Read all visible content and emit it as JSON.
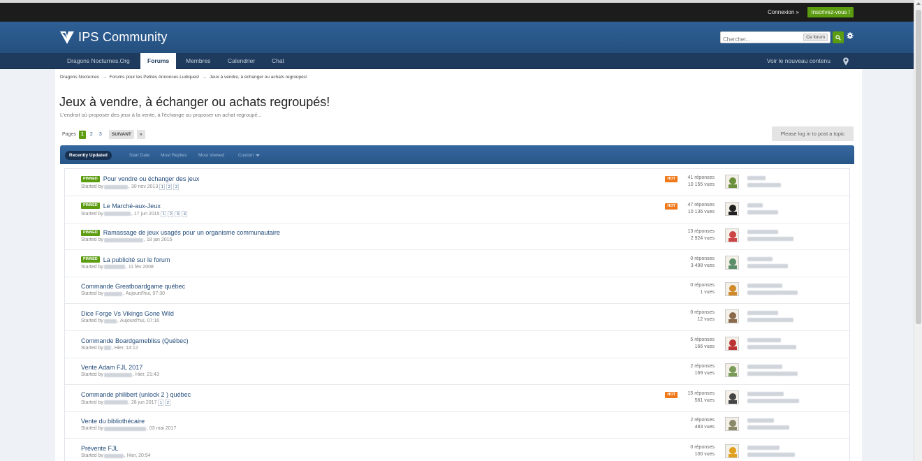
{
  "userbar": {
    "login": "Connexion »",
    "register": "Inscrivez-vous !"
  },
  "header": {
    "site_name": "IPS Community",
    "search_placeholder": "Chercher...",
    "search_scope": "Ce forum"
  },
  "nav": {
    "tabs": [
      "Dragons Nocturnes.Org",
      "Forums",
      "Membres",
      "Calendrier",
      "Chat"
    ],
    "active": "Forums",
    "new_content": "Voir le nouveau contenu"
  },
  "breadcrumb": [
    "Dragons Nocturnes",
    "Forums pour les Petites Annonces Ludiques!",
    "Jeux à vendre, à échanger ou achats regroupés!"
  ],
  "page": {
    "title": "Jeux à vendre, à échanger ou achats regroupés!",
    "description": "L'endroit où proposer des jeux à la vente, à l'échange ou proposer un achat regroupé..."
  },
  "pager": {
    "label": "Pages",
    "pages": [
      "1",
      "2",
      "3"
    ],
    "current": "1",
    "next": "SUIVANT",
    "last": "»"
  },
  "login_to_post": "Please log in to post a topic",
  "filters": [
    "Recently Updated",
    "Start Date",
    "Most Replies",
    "Most Viewed",
    "Custom"
  ],
  "started_by": "Started by",
  "pinned_label": "PINNED",
  "hot_label": "HOT",
  "topics": [
    {
      "title": "Pour vendre ou échanger des jeux",
      "pinned": true,
      "date": "30 nov 2013",
      "pages": [
        "1",
        "2",
        "3"
      ],
      "hot": true,
      "replies": "41 réponses",
      "views": "10 155 vues"
    },
    {
      "title": "Le Marché-aux-Jeux",
      "pinned": true,
      "date": "17 jun 2015",
      "pages": [
        "1",
        "2",
        "3",
        "4"
      ],
      "hot": true,
      "replies": "47 réponses",
      "views": "10 136 vues"
    },
    {
      "title": "Ramassage de jeux usagés pour un organisme communautaire",
      "pinned": true,
      "date": "18 jan 2015",
      "pages": [],
      "hot": false,
      "replies": "13 réponses",
      "views": "2 924 vues"
    },
    {
      "title": "La publicité sur le forum",
      "pinned": true,
      "date": "11 fév 2008",
      "pages": [],
      "hot": false,
      "replies": "0 réponses",
      "views": "3 498 vues"
    },
    {
      "title": "Commande Greatboardgame québec",
      "pinned": false,
      "date": "Aujourd'hui, 07:30",
      "pages": [],
      "hot": false,
      "replies": "0 réponses",
      "views": "1 vues"
    },
    {
      "title": "Dice Forge Vs Vikings Gone Wild",
      "pinned": false,
      "date": "Aujourd'hui, 07:16",
      "pages": [],
      "hot": false,
      "replies": "0 réponses",
      "views": "12 vues"
    },
    {
      "title": "Commande Boardgamebliss (Québec)",
      "pinned": false,
      "date": "Hier, 14:12",
      "pages": [],
      "hot": false,
      "replies": "5 réponses",
      "views": "166 vues"
    },
    {
      "title": "Vente Adam FJL 2017",
      "pinned": false,
      "date": "Hier, 21:43",
      "pages": [],
      "hot": false,
      "replies": "2 réponses",
      "views": "169 vues"
    },
    {
      "title": "Commande philibert (unlock 2 ) québec",
      "pinned": false,
      "date": "28 jun 2017",
      "pages": [
        "1",
        "2"
      ],
      "hot": true,
      "replies": "15 réponses",
      "views": "561 vues"
    },
    {
      "title": "Vente du bibliothécaire",
      "pinned": false,
      "date": "03 mai 2017",
      "pages": [],
      "hot": false,
      "replies": "2 réponses",
      "views": "483 vues"
    },
    {
      "title": "Prévente FJL",
      "pinned": false,
      "date": "Hier, 20:54",
      "pages": [],
      "hot": false,
      "replies": "0 réponses",
      "views": "100 vues"
    }
  ],
  "colors": {
    "brand_blue": "#2f5f95",
    "nav_dark": "#1e3a5c",
    "accent_green": "#5c9c11",
    "hot_orange": "#f07818",
    "link": "#224b7a"
  }
}
